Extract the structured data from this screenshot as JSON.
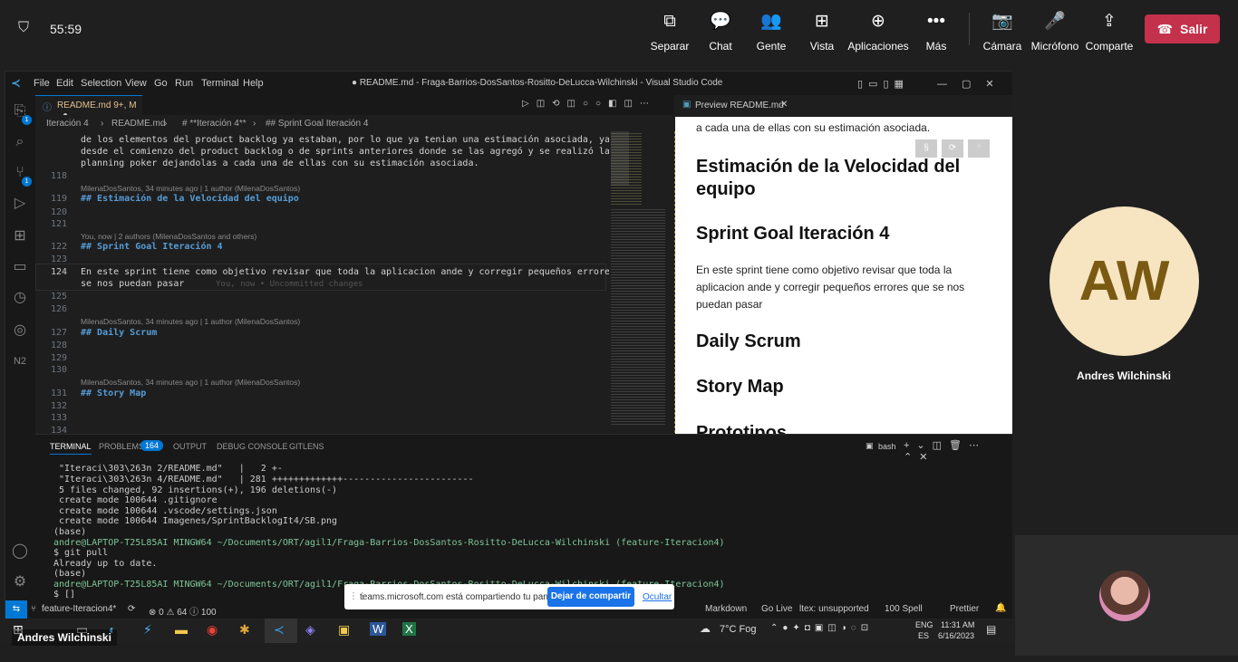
{
  "teams": {
    "timer": "55:59",
    "buttons": [
      {
        "label": "Separar",
        "icon": "popout-icon"
      },
      {
        "label": "Chat",
        "icon": "chat-icon"
      },
      {
        "label": "Gente",
        "icon": "people-icon"
      },
      {
        "label": "Vista",
        "icon": "grid-icon"
      },
      {
        "label": "Aplicaciones",
        "icon": "plus-icon"
      },
      {
        "label": "Más",
        "icon": "more-icon"
      },
      {
        "label": "Cámara",
        "icon": "camera-off-icon"
      },
      {
        "label": "Micrófono",
        "icon": "mic-icon"
      },
      {
        "label": "Comparte",
        "icon": "share-icon"
      }
    ],
    "leave_label": "Salir",
    "participant_initials": "AW",
    "participant_name": "Andres Wilchinski",
    "self_name": "Andres Wilchinski",
    "accent": "#c4314b"
  },
  "vscode": {
    "menu": [
      "File",
      "Edit",
      "Selection",
      "View",
      "Go",
      "Run",
      "Terminal",
      "Help"
    ],
    "window_title": "● README.md - Fraga-Barrios-DosSantos-Rositto-DeLucca-Wilchinski - Visual Studio Code",
    "tab": "README.md 9+, M",
    "preview_tab": "Preview README.md",
    "breadcrumb": [
      "Iteración 4",
      "README.md",
      "# **Iteración 4**",
      "## Sprint Goal Iteración 4"
    ],
    "badges": {
      "explorer": "1",
      "scm": "1"
    },
    "lines": [
      {
        "num": "",
        "text": "de los elementos del product backlog ya estaban, por lo que ya tenian una estimación asociada, ya sea"
      },
      {
        "num": "",
        "text": "desde el comienzo del product backlog o de sprints anteriores donde se las agregó y se realizó la"
      },
      {
        "num": "",
        "text": "planning poker dejandolas a cada una de ellas con su estimación asociada."
      },
      {
        "num": "118",
        "text": ""
      },
      {
        "num": "",
        "blame": "MilenaDosSantos, 34 minutes ago | 1 author (MilenaDosSantos)"
      },
      {
        "num": "119",
        "text": "## Estimación de la Velocidad del equipo",
        "heading": true
      },
      {
        "num": "120",
        "text": ""
      },
      {
        "num": "121",
        "text": ""
      },
      {
        "num": "",
        "blame": "You, now | 2 authors (MilenaDosSantos and others)"
      },
      {
        "num": "122",
        "text": "## Sprint Goal Iteración 4",
        "heading": true
      },
      {
        "num": "123",
        "text": ""
      },
      {
        "num": "124",
        "text": "En este sprint tiene como objetivo revisar que toda la aplicacion ande y corregir pequeños errores que"
      },
      {
        "num": "",
        "text": "se nos puedan pasar",
        "inline": "You, now • Uncommitted changes"
      },
      {
        "num": "125",
        "text": ""
      },
      {
        "num": "126",
        "text": ""
      },
      {
        "num": "",
        "blame": "MilenaDosSantos, 34 minutes ago | 1 author (MilenaDosSantos)"
      },
      {
        "num": "127",
        "text": "## Daily Scrum",
        "heading": true
      },
      {
        "num": "128",
        "text": ""
      },
      {
        "num": "129",
        "text": ""
      },
      {
        "num": "130",
        "text": ""
      },
      {
        "num": "",
        "blame": "MilenaDosSantos, 34 minutes ago | 1 author (MilenaDosSantos)"
      },
      {
        "num": "131",
        "text": "## Story Map",
        "heading": true
      },
      {
        "num": "132",
        "text": ""
      },
      {
        "num": "133",
        "text": ""
      },
      {
        "num": "134",
        "text": ""
      }
    ],
    "preview": {
      "top_text": "a cada una de ellas con su estimación asociada.",
      "h1": "Estimación de la Velocidad del equipo",
      "h2": "Sprint Goal Iteración 4",
      "para": "En este sprint tiene como objetivo revisar que toda la aplicacion ande y corregir pequeños errores que se nos puedan pasar",
      "h3": "Daily Scrum",
      "h4": "Story Map",
      "h5": "Prototipos"
    },
    "panel_tabs": [
      "TERMINAL",
      "PROBLEMS",
      "OUTPUT",
      "DEBUG CONSOLE",
      "GITLENS"
    ],
    "problems_count": "164",
    "shell_label": "bash",
    "terminal": [
      " \"Iteraci\\303\\263n 2/README.md\"   |   2 +-",
      " \"Iteraci\\303\\263n 4/README.md\"   | 281 +++++++++++++------------------------",
      " 5 files changed, 92 insertions(+), 196 deletions(-)",
      " create mode 100644 .gitignore",
      " create mode 100644 .vscode/settings.json",
      " create mode 100644 Imagenes/SprintBacklogIt4/SB.png",
      "(base)",
      "andre@LAPTOP-T25L85AI MINGW64 ~/Documents/ORT/agil1/Fraga-Barrios-DosSantos-Rositto-DeLucca-Wilchinski (feature-Iteracion4)",
      "$ git pull",
      "Already up to date.",
      "(base)",
      "andre@LAPTOP-T25L85AI MINGW64 ~/Documents/ORT/agil1/Fraga-Barrios-DosSantos-Rositto-DeLucca-Wilchinski (feature-Iteracion4)",
      "$ []"
    ],
    "status": {
      "branch": "feature-Iteracion4*",
      "problems": "⊗ 0 ⚠ 64 ⓘ 100",
      "right_items": [
        "Markdown",
        "Go Live",
        "ltex: unsupported",
        "100 Spell",
        "Prettier"
      ]
    }
  },
  "share_banner": {
    "text": "teams.microsoft.com está compartiendo tu pantalla.",
    "stop_label": "Dejar de compartir",
    "hide_label": "Ocultar"
  },
  "taskbar": {
    "weather": "7°C Fog",
    "lang": "ENG",
    "lang2": "ES",
    "time": "11:31 AM",
    "date": "6/16/2023"
  }
}
